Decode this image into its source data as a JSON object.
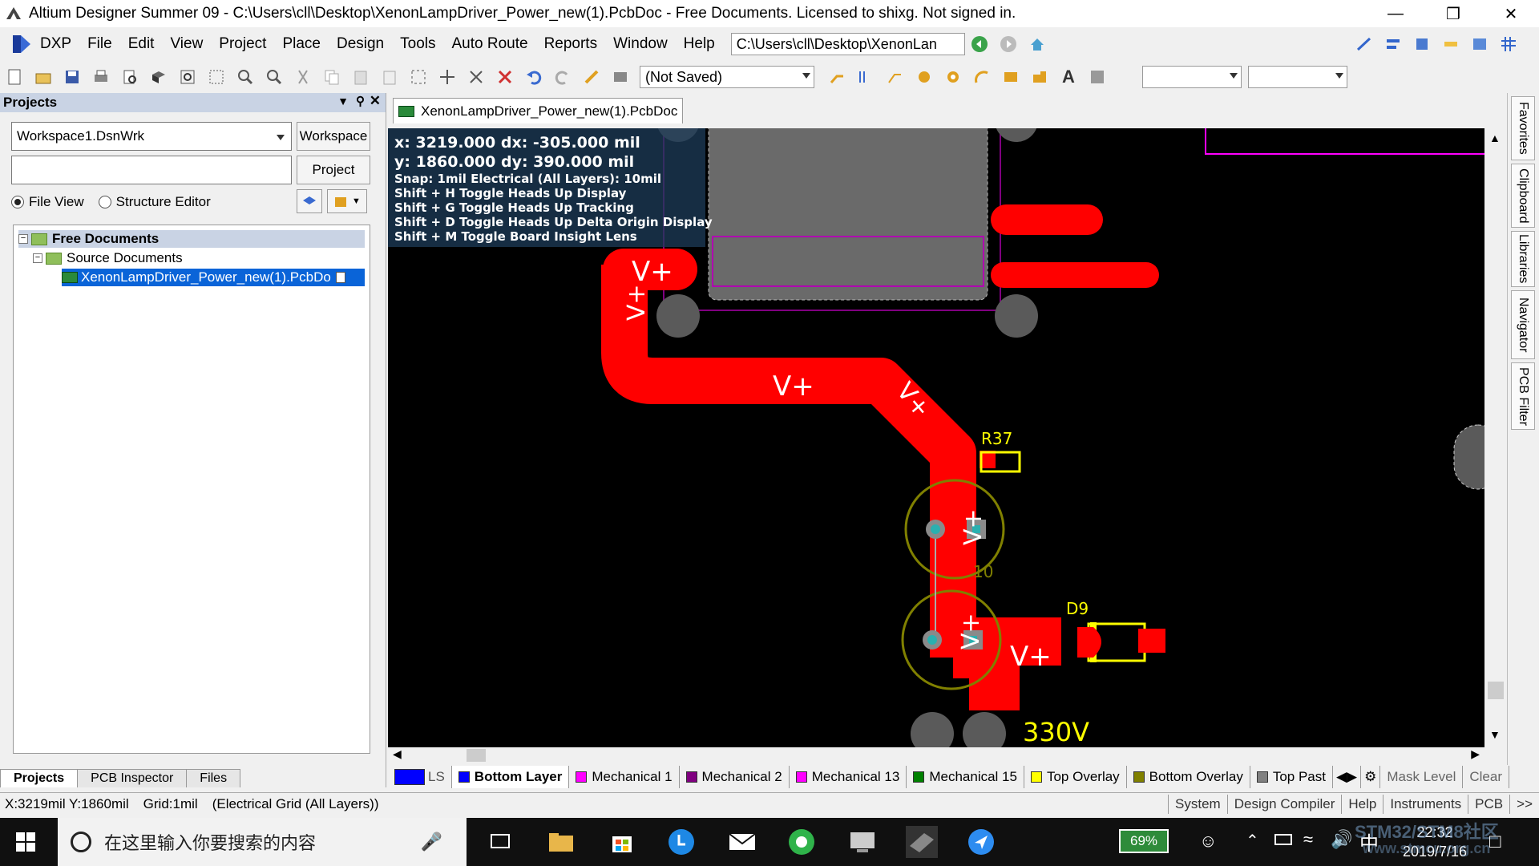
{
  "window": {
    "title": "Altium Designer Summer 09 - C:\\Users\\cll\\Desktop\\XenonLampDriver_Power_new(1).PcbDoc - Free Documents. Licensed to shixg. Not signed in."
  },
  "menu": {
    "items": [
      "DXP",
      "File",
      "Edit",
      "View",
      "Project",
      "Place",
      "Design",
      "Tools",
      "Auto Route",
      "Reports",
      "Window",
      "Help"
    ],
    "path": "C:\\Users\\cll\\Desktop\\XenonLan"
  },
  "toolbar": {
    "save_state": "(Not Saved)"
  },
  "panel": {
    "title": "Projects",
    "workspace_value": "Workspace1.DsnWrk",
    "workspace_button": "Workspace",
    "project_button": "Project",
    "file_view": "File View",
    "structure_editor": "Structure Editor",
    "tree": {
      "root": "Free Documents",
      "folder": "Source Documents",
      "file": "XenonLampDriver_Power_new(1).PcbDo"
    },
    "tabs": [
      "Projects",
      "PCB Inspector",
      "Files"
    ]
  },
  "document_tab": "XenonLampDriver_Power_new(1).PcbDoc",
  "hud": {
    "line1": "x: 3219.000   dx: -305.000 mil",
    "line2": "y: 1860.000   dy:  390.000 mil",
    "snap": "Snap: 1mil Electrical (All Layers): 10mil",
    "h1": "Shift + H  Toggle Heads Up Display",
    "h2": "Shift + G  Toggle Heads Up Tracking",
    "h3": "Shift + D  Toggle Heads Up Delta Origin Display",
    "h4": "Shift + M  Toggle Board Insight Lens"
  },
  "pcb": {
    "net": "V+",
    "designators": [
      "R37",
      "D9",
      "330V",
      "10"
    ],
    "colors": {
      "copper": "#ff0000",
      "overlay": "#ffff00",
      "pad": "#5a5a5a",
      "keepout": "#800080"
    }
  },
  "side_tabs": [
    "Favorites",
    "Clipboard",
    "Libraries",
    "Navigator",
    "PCB Filter"
  ],
  "layers": {
    "ls": "LS",
    "tabs": [
      {
        "name": "Bottom Layer",
        "color": "#0000ff",
        "active": true
      },
      {
        "name": "Mechanical 1",
        "color": "#ff00ff"
      },
      {
        "name": "Mechanical 2",
        "color": "#800080"
      },
      {
        "name": "Mechanical 13",
        "color": "#ff00ff"
      },
      {
        "name": "Mechanical 15",
        "color": "#008000"
      },
      {
        "name": "Top Overlay",
        "color": "#ffff00"
      },
      {
        "name": "Bottom Overlay",
        "color": "#808000"
      },
      {
        "name": "Top Past",
        "color": "#808080"
      }
    ],
    "mask_level": "Mask Level",
    "clear": "Clear"
  },
  "status": {
    "coords": "X:3219mil Y:1860mil",
    "grid": "Grid:1mil",
    "grid_mode": "(Electrical Grid (All Layers))",
    "buttons": [
      "System",
      "Design Compiler",
      "Help",
      "Instruments",
      "PCB",
      ">>"
    ]
  },
  "taskbar": {
    "search_placeholder": "在这里输入你要搜索的内容",
    "battery": "69%",
    "ime": "中",
    "time": "22:32",
    "date": "2019/7/16",
    "watermark": "STM32/STM8社区",
    "watermark2": "www.stmcu.org.cn"
  }
}
